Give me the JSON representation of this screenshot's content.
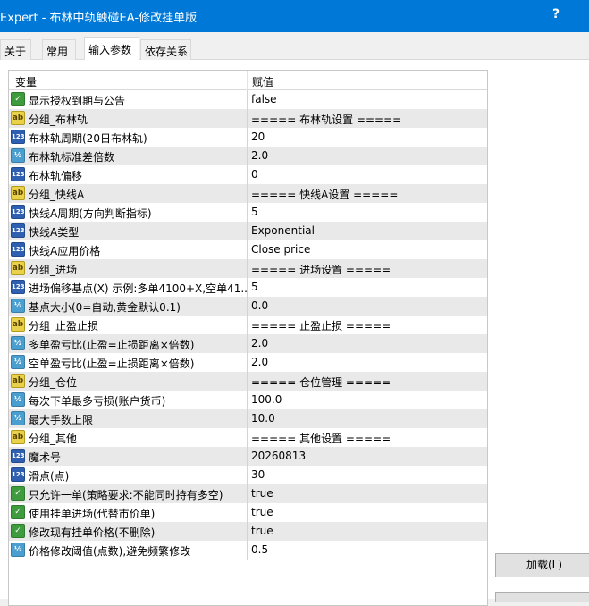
{
  "window": {
    "title": "Expert - 布林中轨触碰EA-修改挂单版",
    "help": "?"
  },
  "tabs": [
    {
      "label": "关于"
    },
    {
      "label": "常用"
    },
    {
      "label": "输入参数"
    },
    {
      "label": "依存关系"
    }
  ],
  "grid": {
    "col_variable": "变量",
    "col_value": "赋值",
    "rows": [
      {
        "type": "bool",
        "name": "显示授权到期与公告",
        "value": "false"
      },
      {
        "type": "str",
        "name": "分组_布林轨",
        "value": "===== 布林轨设置 ====="
      },
      {
        "type": "int",
        "name": "布林轨周期(20日布林轨)",
        "value": "20"
      },
      {
        "type": "dbl",
        "name": "布林轨标准差倍数",
        "value": "2.0"
      },
      {
        "type": "int",
        "name": "布林轨偏移",
        "value": "0"
      },
      {
        "type": "str",
        "name": "分组_快线A",
        "value": "===== 快线A设置 ====="
      },
      {
        "type": "int",
        "name": "快线A周期(方向判断指标)",
        "value": "5"
      },
      {
        "type": "int",
        "name": "快线A类型",
        "value": "Exponential"
      },
      {
        "type": "int",
        "name": "快线A应用价格",
        "value": "Close price"
      },
      {
        "type": "str",
        "name": "分组_进场",
        "value": "===== 进场设置 ====="
      },
      {
        "type": "int",
        "name": "进场偏移基点(X) 示例:多单4100+X,空单41...",
        "value": "5"
      },
      {
        "type": "dbl",
        "name": "基点大小(0=自动,黄金默认0.1)",
        "value": "0.0"
      },
      {
        "type": "str",
        "name": "分组_止盈止损",
        "value": "===== 止盈止损 ====="
      },
      {
        "type": "dbl",
        "name": "多单盈亏比(止盈=止损距离×倍数)",
        "value": "2.0"
      },
      {
        "type": "dbl",
        "name": "空单盈亏比(止盈=止损距离×倍数)",
        "value": "2.0"
      },
      {
        "type": "str",
        "name": "分组_仓位",
        "value": "===== 仓位管理 ====="
      },
      {
        "type": "dbl",
        "name": "每次下单最多亏损(账户货币)",
        "value": "100.0"
      },
      {
        "type": "dbl",
        "name": "最大手数上限",
        "value": "10.0"
      },
      {
        "type": "str",
        "name": "分组_其他",
        "value": "===== 其他设置 ====="
      },
      {
        "type": "int",
        "name": "魔术号",
        "value": "20260813"
      },
      {
        "type": "int",
        "name": "滑点(点)",
        "value": "30"
      },
      {
        "type": "bool",
        "name": "只允许一单(策略要求:不能同时持有多空)",
        "value": "true"
      },
      {
        "type": "bool",
        "name": "使用挂单进场(代替市价单)",
        "value": "true"
      },
      {
        "type": "bool",
        "name": "修改现有挂单价格(不删除)",
        "value": "true"
      },
      {
        "type": "dbl",
        "name": "价格修改阈值(点数),避免频繁修改",
        "value": "0.5"
      }
    ]
  },
  "buttons": {
    "load": "加载(L)"
  },
  "icon_labels": {
    "bool": "✓",
    "str": "ab",
    "int": "123",
    "dbl": "½"
  },
  "colors": {
    "titlebar": "#0078d7",
    "row_alt": "#e9e9e9"
  }
}
